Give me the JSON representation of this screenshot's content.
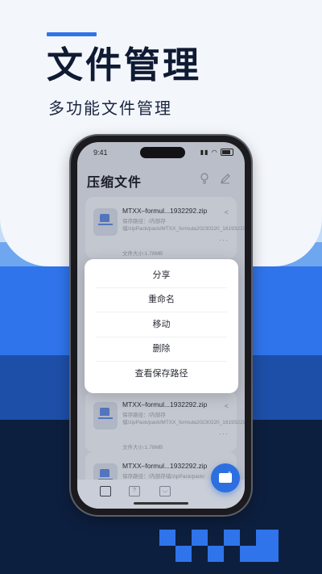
{
  "promo": {
    "headline": "文件管理",
    "subheadline": "多功能文件管理"
  },
  "status_bar": {
    "time": "9:41"
  },
  "app": {
    "title": "压缩文件"
  },
  "files": [
    {
      "name": "MTXX–formul...1932292.zip",
      "path": "保存路径：/内部存储/zipPack/pack/MTXX_formula20230220_161932292.Zip",
      "size": "文件大小:1.78MB"
    },
    {
      "name": "MTXX–formul...1932292.zip",
      "path": "保存路径：/内部存储/zipPack/pack/MTXX_formula20230220_161932292.Zip",
      "size": "文件大小:1.78MB"
    },
    {
      "name": "MTXX–formul...1932292.zip",
      "path": "保存路径：/内部存储/zipPack/pack/",
      "size": ""
    }
  ],
  "context_menu": {
    "items": [
      "分享",
      "重命名",
      "移动",
      "删除",
      "查看保存路径"
    ]
  },
  "colors": {
    "accent": "#2f74ea",
    "navy": "#0d1f3f",
    "band_light": "#c4dcf7",
    "band_mid": "#2f74ea"
  },
  "icons": {
    "top_left": "lightbulb-icon",
    "top_right": "pencil-icon",
    "card_share": "share-icon",
    "card_more": "more-dots-icon",
    "fab": "add-folder-icon",
    "tabs": [
      "zip-tab-icon",
      "document-tab-icon",
      "profile-tab-icon"
    ]
  }
}
